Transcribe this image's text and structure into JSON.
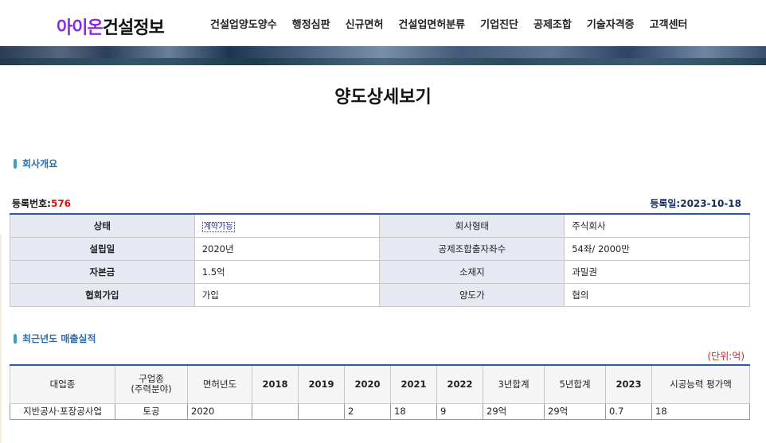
{
  "header": {
    "logo_brand": "아이온",
    "logo_rest": "건설정보",
    "nav": [
      "건설업양도양수",
      "행정심판",
      "신규면허",
      "건설업면허분류",
      "기업진단",
      "공제조합",
      "기술자격증",
      "고객센터"
    ]
  },
  "page_title": "양도상세보기",
  "overview": {
    "section_title": "회사개요",
    "reg_no_label": "등록번호:",
    "reg_no": "576",
    "reg_date_label": "등록일:",
    "reg_date": "2023-10-18",
    "rows": [
      {
        "l1": "상태",
        "v1": "계약가능",
        "l2": "회사형태",
        "v2": "주식회사"
      },
      {
        "l1": "설립일",
        "v1": "2020년",
        "l2": "공제조합출자좌수",
        "v2": "54좌/ 2000만"
      },
      {
        "l1": "자본금",
        "v1": "1.5억",
        "l2": "소재지",
        "v2": "과밀권"
      },
      {
        "l1": "협회가입",
        "v1": "가입",
        "l2": "양도가",
        "v2": "협의"
      }
    ]
  },
  "sales": {
    "section_title": "최근년도 매출실적",
    "unit": "(단위:억)",
    "headers": [
      "대업종",
      "구업종\n(주력분야)",
      "면허년도",
      "2018",
      "2019",
      "2020",
      "2021",
      "2022",
      "3년합계",
      "5년합계",
      "2023",
      "시공능력 평가액"
    ],
    "row": [
      "지반공사·포장공사업",
      "토공",
      "2020",
      "",
      "",
      "2",
      "18",
      "9",
      "29억",
      "29억",
      "0.7",
      "18"
    ]
  },
  "colors": {
    "brand": "#8a2be2",
    "section": "#2a6fb0",
    "reg_no": "#dd1111",
    "unit": "#c0282a",
    "table_border_top": "#2a5aa0"
  }
}
